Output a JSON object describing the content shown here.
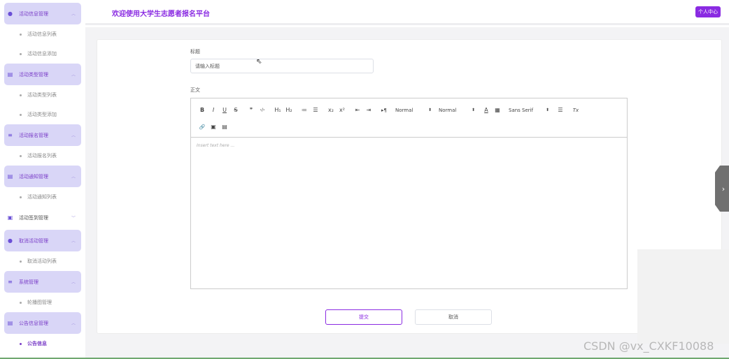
{
  "header": {
    "title": "欢迎使用大学生志愿者报名平台",
    "user_center": "个人中心"
  },
  "sidebar": {
    "groups": [
      {
        "label": "活动信息管理",
        "expanded": true,
        "items": [
          "活动信息列表",
          "活动信息添加"
        ]
      },
      {
        "label": "活动类型管理",
        "expanded": true,
        "items": [
          "活动类型列表",
          "活动类型添加"
        ]
      },
      {
        "label": "活动报名管理",
        "expanded": true,
        "items": [
          "活动报名列表"
        ]
      },
      {
        "label": "活动通知管理",
        "expanded": true,
        "items": [
          "活动通知列表"
        ]
      },
      {
        "label": "活动签到管理",
        "expanded": false,
        "items": []
      },
      {
        "label": "取消活动管理",
        "expanded": true,
        "items": [
          "取消活动列表"
        ]
      },
      {
        "label": "系统管理",
        "expanded": true,
        "items": [
          "轮播图管理"
        ]
      },
      {
        "label": "公告信息管理",
        "expanded": true,
        "items": [
          "公告信息"
        ]
      }
    ],
    "active_item": "公告信息"
  },
  "form": {
    "title_label": "标题",
    "title_placeholder": "请输入标题",
    "body_label": "正文",
    "editor_placeholder": "Insert text here ...",
    "submit": "提交",
    "cancel": "取消"
  },
  "toolbar": {
    "bold": "B",
    "italic": "I",
    "underline": "U",
    "strike": "S",
    "quote": "❞",
    "code": "‹/›",
    "h1": "H₁",
    "h2": "H₂",
    "ordered_list": "≔",
    "bullet_list": "☰",
    "subscript": "x₂",
    "superscript": "x²",
    "outdent": "⇤",
    "indent": "⇥",
    "direction": "▸¶",
    "size_select": "Normal",
    "header_select": "Normal",
    "color": "A",
    "background": "▦",
    "font_select": "Sans Serif",
    "align": "☰",
    "clean": "Tx",
    "link": "🔗",
    "image": "▣",
    "video": "▤"
  },
  "watermark": "CSDN @vx_CXKF10088",
  "colors": {
    "accent": "#8a2be2",
    "sidebar_group_bg": "#d9d6f7"
  }
}
